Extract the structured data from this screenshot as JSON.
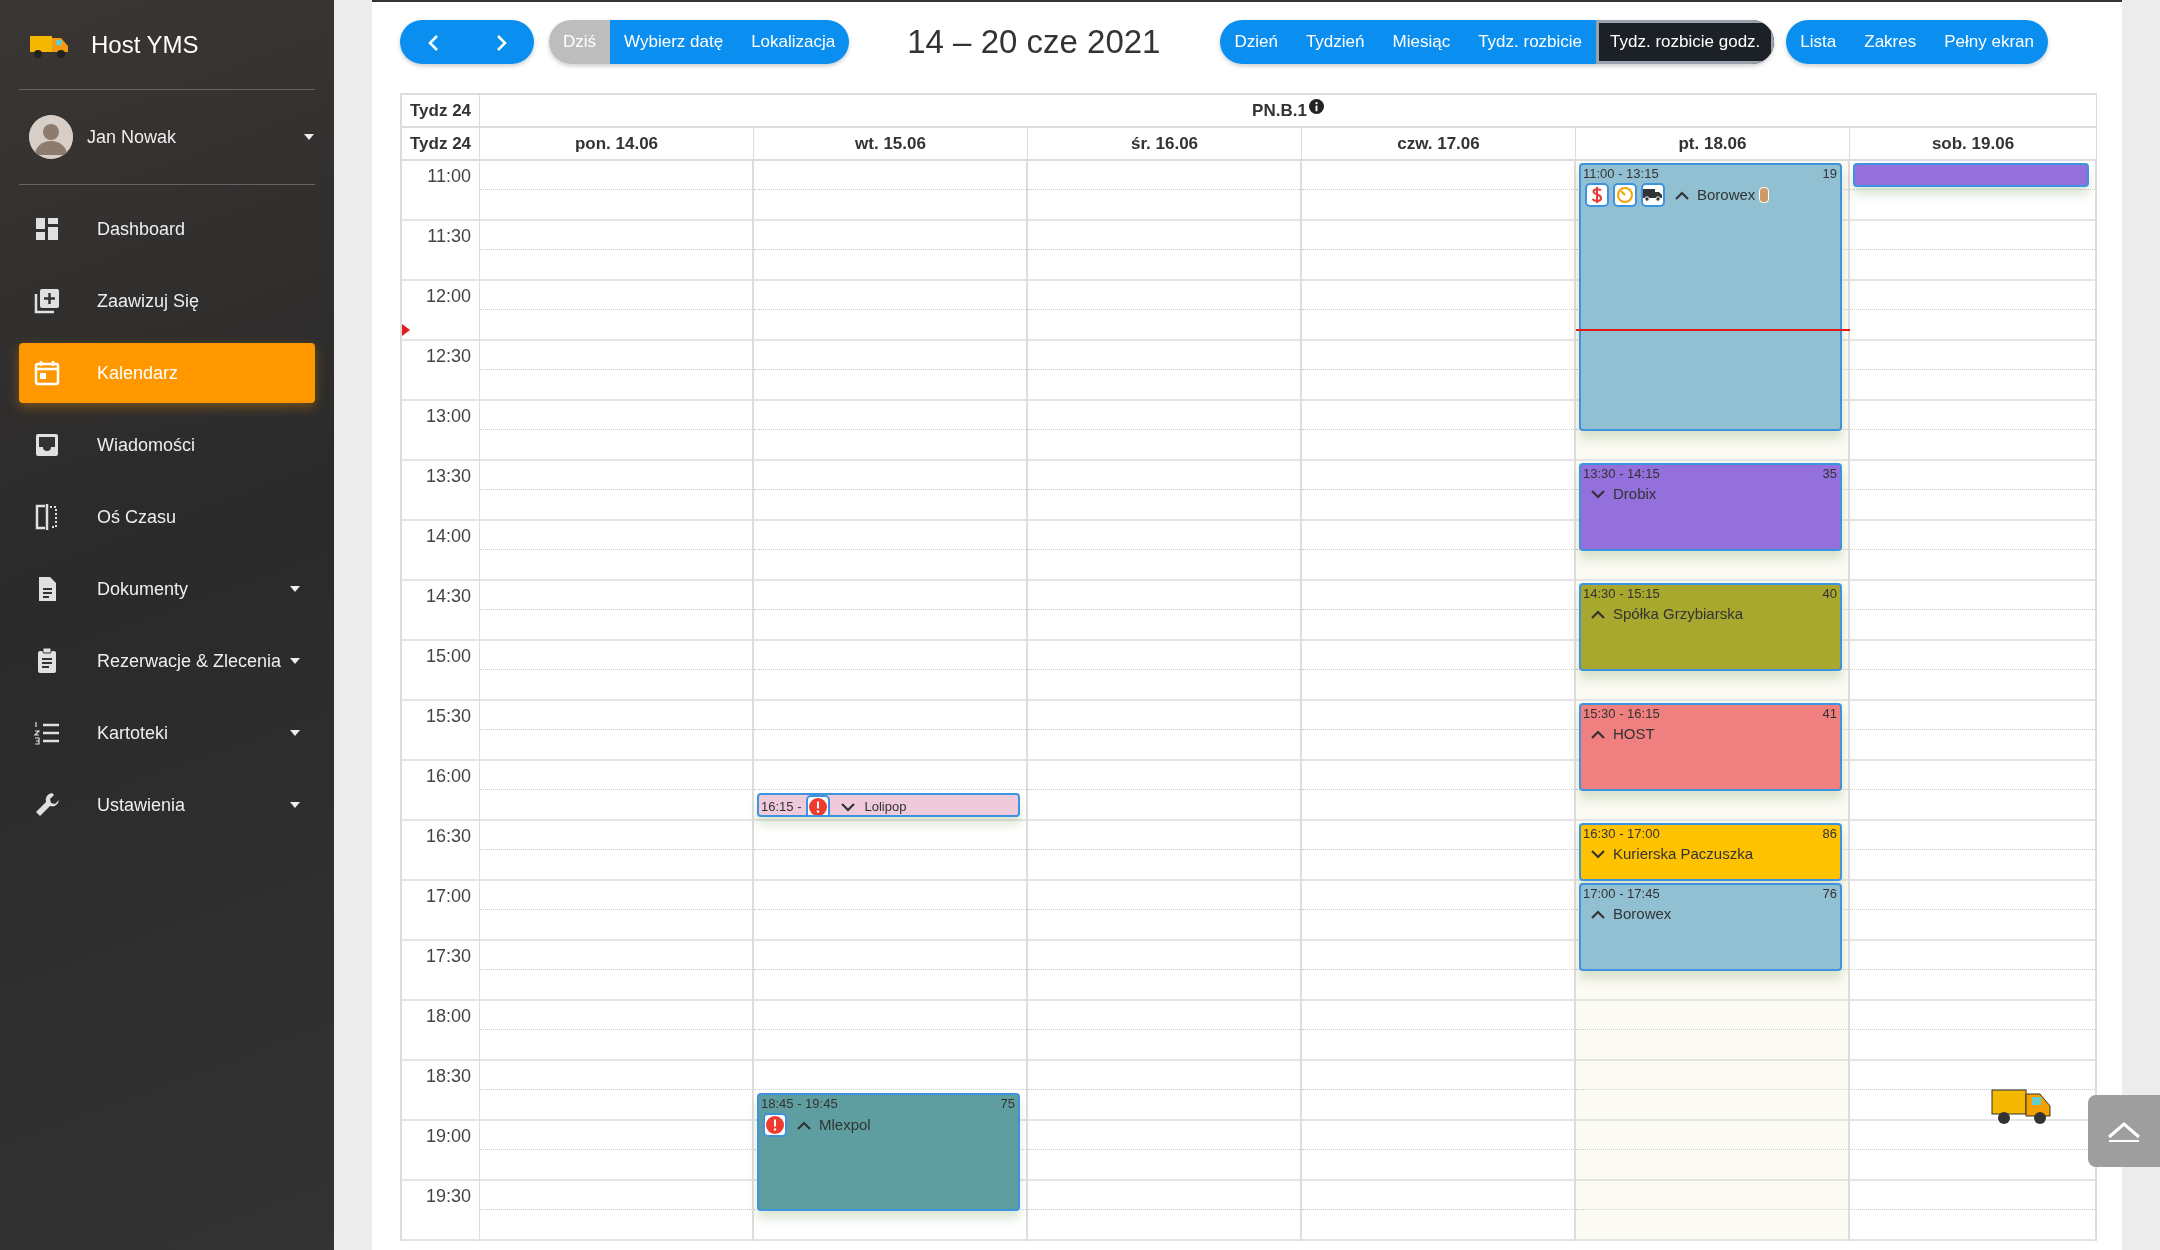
{
  "sidebar": {
    "brand": "Host YMS",
    "user": {
      "name": "Jan Nowak"
    },
    "items": [
      {
        "label": "Dashboard",
        "selected": false,
        "has_submenu": false
      },
      {
        "label": "Zaawizuj Się",
        "selected": false,
        "has_submenu": false
      },
      {
        "label": "Kalendarz",
        "selected": true,
        "has_submenu": false
      },
      {
        "label": "Wiadomości",
        "selected": false,
        "has_submenu": false
      },
      {
        "label": "Oś Czasu",
        "selected": false,
        "has_submenu": false
      },
      {
        "label": "Dokumenty",
        "selected": false,
        "has_submenu": true
      },
      {
        "label": "Rezerwacje & Zlecenia",
        "selected": false,
        "has_submenu": true
      },
      {
        "label": "Kartoteki",
        "selected": false,
        "has_submenu": true
      },
      {
        "label": "Ustawienia",
        "selected": false,
        "has_submenu": true
      }
    ]
  },
  "toolbar": {
    "date_buttons": [
      {
        "label": "Dziś",
        "disabled": true
      },
      {
        "label": "Wybierz datę",
        "disabled": false
      },
      {
        "label": "Lokalizacja",
        "disabled": false
      }
    ],
    "title": "14 – 20 cze 2021",
    "views": [
      {
        "label": "Dzień",
        "selected": false
      },
      {
        "label": "Tydzień",
        "selected": false
      },
      {
        "label": "Miesiąc",
        "selected": false
      },
      {
        "label": "Tydz. rozbicie",
        "selected": false
      },
      {
        "label": "Tydz. rozbicie godz.",
        "selected": true
      }
    ],
    "extra_buttons": [
      "Lista",
      "Zakres",
      "Pełny ekran"
    ]
  },
  "calendar": {
    "week_label": "Tydz 24",
    "resource": "PN.B.1",
    "week_label_days": "Tydz 24",
    "times": [
      "11:00",
      "11:30",
      "12:00",
      "12:30",
      "13:00",
      "13:30",
      "14:00",
      "14:30",
      "15:00",
      "15:30",
      "16:00",
      "16:30",
      "17:00",
      "17:30",
      "18:00",
      "18:30",
      "19:00",
      "19:30"
    ],
    "days": [
      {
        "label": "pon. 14.06",
        "today": false
      },
      {
        "label": "wt. 15.06",
        "today": false,
        "events": [
          {
            "time": "16:15 -",
            "name": "Lolipop",
            "color": "#eecadb",
            "expanded": false,
            "badges": [
              {
                "kind": "alert"
              }
            ]
          },
          {
            "time": "18:45 - 19:45",
            "number": "75",
            "name": "Mlexpol",
            "color": "#5f9ea0",
            "expanded": true,
            "badges": [
              {
                "kind": "alert"
              }
            ]
          }
        ]
      },
      {
        "label": "śr. 16.06",
        "today": false
      },
      {
        "label": "czw. 17.06",
        "today": false
      },
      {
        "label": "pt. 18.06",
        "today": true,
        "events": [
          {
            "time": "11:00 - 13:15",
            "number": "19",
            "name": "Borowex",
            "color": "#92c0d3",
            "expanded": true,
            "badges": [
              {
                "kind": "dollar"
              },
              {
                "kind": "timer"
              },
              {
                "kind": "truck"
              }
            ],
            "tag": true
          },
          {
            "time": "13:30 - 14:15",
            "number": "35",
            "name": "Drobix",
            "color": "#9370db",
            "expanded": false
          },
          {
            "time": "14:30 - 15:15",
            "number": "40",
            "name": "Spółka Grzybiarska",
            "color": "#a8a72e",
            "expanded": true
          },
          {
            "time": "15:30 - 16:15",
            "number": "41",
            "name": "HOST",
            "color": "#f07f7f",
            "expanded": true
          },
          {
            "time": "16:30 - 17:00",
            "number": "86",
            "name": "Kurierska Paczuszka",
            "color": "#ffc200",
            "expanded": false
          },
          {
            "time": "17:00 - 17:45",
            "number": "76",
            "name": "Borowex",
            "color": "#92c0d3",
            "expanded": true
          }
        ]
      },
      {
        "label": "sob. 19.06",
        "today": false,
        "events": [
          {
            "color": "#9370db"
          }
        ]
      }
    ]
  }
}
